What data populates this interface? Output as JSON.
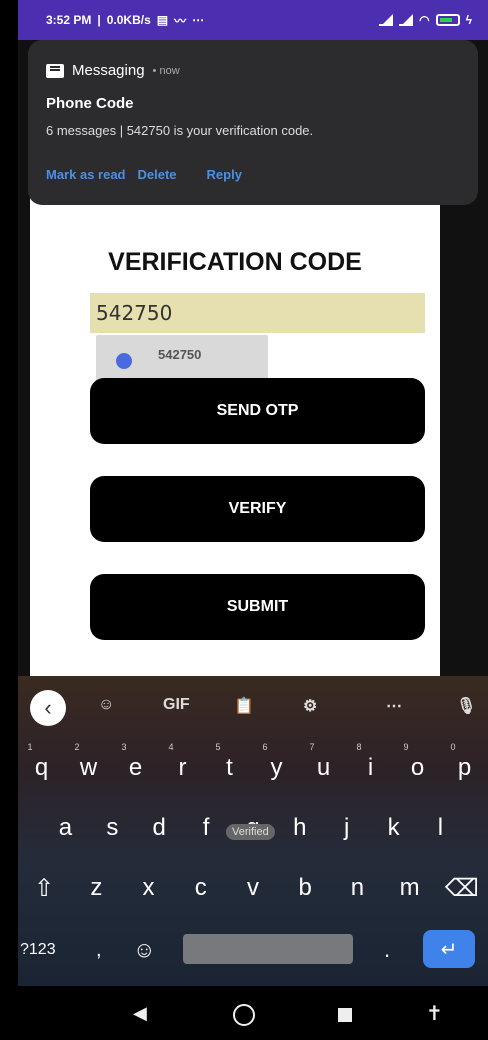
{
  "status": {
    "time": "3:52 PM",
    "speed": "0.0KB/s",
    "extra": "⋯"
  },
  "notification": {
    "app": "Messaging",
    "time": "• now",
    "title": "Phone Code",
    "body": "6 messages | 542750 is your verification code.",
    "actions": [
      "Mark as read",
      "Delete",
      "Reply"
    ]
  },
  "page": {
    "title": "VERIFICATION CODE",
    "otp_value": "542750",
    "suggestion": "542750",
    "buttons": {
      "send": "SEND OTP",
      "verify": "VERIFY",
      "submit": "SUBMIT"
    }
  },
  "keyboard": {
    "tools": [
      "GIF"
    ],
    "row1": [
      "q",
      "w",
      "e",
      "r",
      "t",
      "y",
      "u",
      "i",
      "o",
      "p"
    ],
    "row1_hints": [
      "1",
      "2",
      "3",
      "4",
      "5",
      "6",
      "7",
      "8",
      "9",
      "0"
    ],
    "row2": [
      "a",
      "s",
      "d",
      "f",
      "g",
      "h",
      "j",
      "k",
      "l"
    ],
    "row3": [
      "z",
      "x",
      "c",
      "v",
      "b",
      "n",
      "m"
    ],
    "symbols": "?123",
    "comma": ",",
    "period": ".",
    "toast": "Verified"
  },
  "colors": {
    "status_bar": "#4b2fb0",
    "input_bg": "#e6dfb0",
    "accent": "#3f83ea",
    "notification_action": "#4b8fe8"
  }
}
